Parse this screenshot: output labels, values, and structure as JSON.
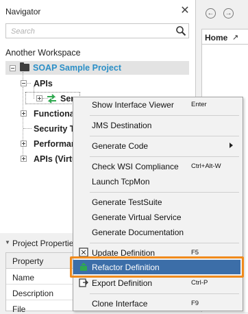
{
  "navigator": {
    "title": "Navigator",
    "close_glyph": "✕",
    "search_placeholder": "Search",
    "workspace": "Another Workspace",
    "project": "SOAP Sample Project",
    "tree": [
      {
        "label": "APIs",
        "expander": "minus"
      },
      {
        "label": "Ser",
        "expander": "plus"
      },
      {
        "label": "Functional",
        "expander": "plus"
      },
      {
        "label": "Security T",
        "expander": "none"
      },
      {
        "label": "Performan",
        "expander": "plus"
      },
      {
        "label": "APIs (Virtu",
        "expander": "plus"
      }
    ]
  },
  "editor": {
    "back_glyph": "←",
    "forward_glyph": "→",
    "tab_label": "Home",
    "tab_icon_glyph": "↗"
  },
  "properties": {
    "title": "Project Properties",
    "collapse_glyph": "▼",
    "header": "Property",
    "rows": [
      "Name",
      "Description",
      "File"
    ]
  },
  "context_menu": {
    "items": [
      {
        "label": "Show Interface Viewer",
        "shortcut": "Enter"
      },
      {
        "label": "JMS Destination",
        "shortcut": ""
      },
      {
        "label": "Generate Code",
        "shortcut": "",
        "submenu": true
      },
      {
        "label": "Check WSI Compliance",
        "shortcut": "Ctrl+Alt-W"
      },
      {
        "label": "Launch TcpMon",
        "shortcut": ""
      },
      {
        "label": "Generate TestSuite",
        "shortcut": ""
      },
      {
        "label": "Generate Virtual Service",
        "shortcut": ""
      },
      {
        "label": "Generate Documentation",
        "shortcut": ""
      },
      {
        "label": "Update Definition",
        "shortcut": "F5"
      },
      {
        "label": "Refactor Definition",
        "shortcut": "",
        "highlighted": true
      },
      {
        "label": "Export Definition",
        "shortcut": "Ctrl-P"
      },
      {
        "label": "Clone Interface",
        "shortcut": "F9"
      }
    ]
  },
  "colors": {
    "accent_blue": "#2b8fc7",
    "highlight_fill": "#3c6ea8",
    "highlight_border": "#f08a1c",
    "icon_green": "#2fa84f"
  }
}
